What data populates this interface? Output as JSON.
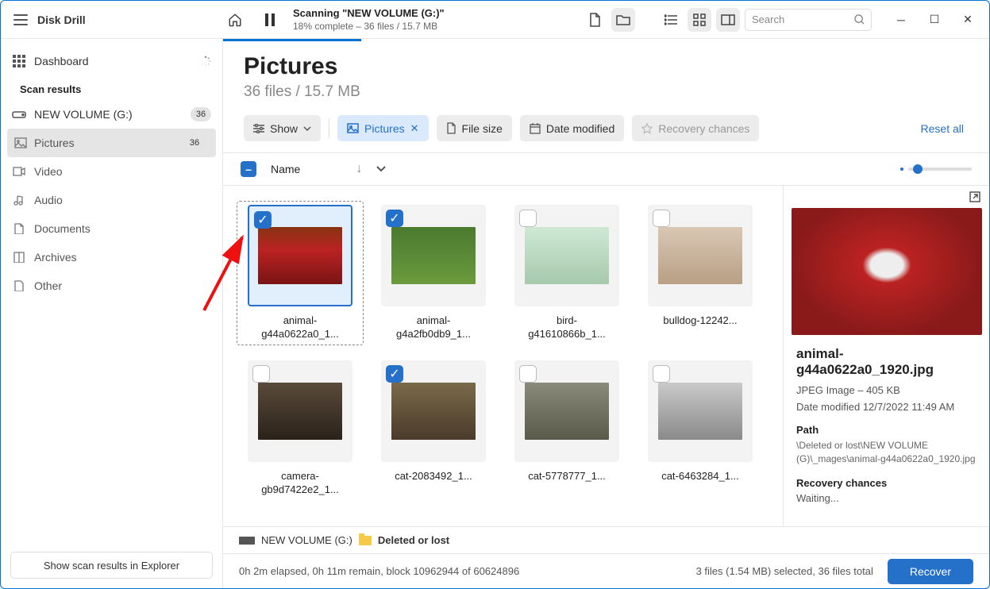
{
  "app_name": "Disk Drill",
  "scan": {
    "title": "Scanning \"NEW VOLUME (G:)\"",
    "subtitle": "18% complete – 36 files / 15.7 MB"
  },
  "search_placeholder": "Search",
  "sidebar": {
    "dashboard": "Dashboard",
    "section": "Scan results",
    "volume": {
      "label": "NEW VOLUME (G:)",
      "count": "36"
    },
    "categories": [
      {
        "label": "Pictures",
        "count": "36",
        "selected": true
      },
      {
        "label": "Video"
      },
      {
        "label": "Audio"
      },
      {
        "label": "Documents"
      },
      {
        "label": "Archives"
      },
      {
        "label": "Other"
      }
    ],
    "footer_btn": "Show scan results in Explorer"
  },
  "page": {
    "title": "Pictures",
    "subtitle": "36 files / 15.7 MB"
  },
  "filters": {
    "show": "Show",
    "pictures": "Pictures",
    "file_size": "File size",
    "date_modified": "Date modified",
    "recovery": "Recovery chances",
    "reset": "Reset all"
  },
  "list_header": {
    "name": "Name"
  },
  "items": [
    {
      "label": "animal-\ng44a0622a0_1...",
      "checked": true,
      "selected": true,
      "thumb": "thumb-dog-red"
    },
    {
      "label": "animal-\ng4a2fb0db9_1...",
      "checked": true,
      "thumb": "thumb-dog-grass"
    },
    {
      "label": "bird-\ng41610866b_1...",
      "thumb": "thumb-bird"
    },
    {
      "label": "bulldog-12242...",
      "thumb": "thumb-bulldog"
    },
    {
      "label": "camera-\ngb9d7422e2_1...",
      "thumb": "thumb-camera"
    },
    {
      "label": "cat-2083492_1...",
      "checked": true,
      "thumb": "thumb-cat1"
    },
    {
      "label": "cat-5778777_1...",
      "thumb": "thumb-cat2"
    },
    {
      "label": "cat-6463284_1...",
      "thumb": "thumb-cat3"
    }
  ],
  "details": {
    "filename": "animal-g44a0622a0_1920.jpg",
    "meta": "JPEG Image – 405 KB",
    "date": "Date modified 12/7/2022 11:49 AM",
    "path_label": "Path",
    "path": "\\Deleted or lost\\NEW VOLUME (G)\\_mages\\animal-g44a0622a0_1920.jpg",
    "rc_label": "Recovery chances",
    "rc_value": "Waiting..."
  },
  "breadcrumb": {
    "drive": "NEW VOLUME (G:)",
    "folder": "Deleted or lost"
  },
  "status": {
    "left": "0h 2m elapsed, 0h 11m remain, block 10962944 of 60624896",
    "right": "3 files (1.54 MB) selected, 36 files total",
    "recover": "Recover"
  }
}
